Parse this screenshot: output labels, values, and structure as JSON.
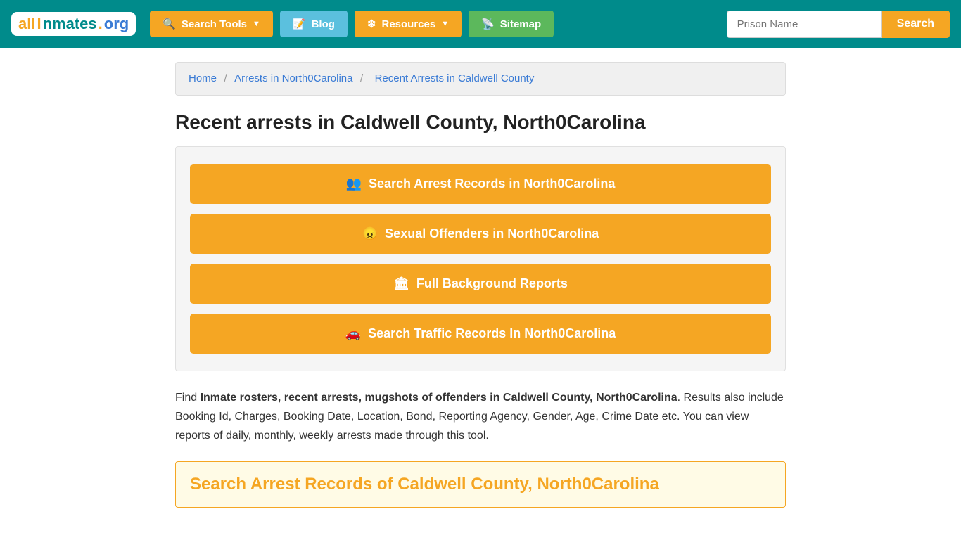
{
  "navbar": {
    "logo": {
      "all": "all",
      "inmates": "Inmates",
      "dot": ".",
      "org": "org"
    },
    "search_tools_label": "Search Tools",
    "blog_label": "Blog",
    "resources_label": "Resources",
    "sitemap_label": "Sitemap",
    "prison_name_placeholder": "Prison Name",
    "search_button_label": "Search"
  },
  "breadcrumb": {
    "home": "Home",
    "arrests": "Arrests in North0Carolina",
    "current": "Recent Arrests in Caldwell County"
  },
  "page": {
    "title": "Recent arrests in Caldwell County, North0Carolina"
  },
  "buttons": {
    "arrest_records": "Search Arrest Records in North0Carolina",
    "sexual_offenders": "Sexual Offenders in North0Carolina",
    "background_reports": "Full Background Reports",
    "traffic_records": "Search Traffic Records In North0Carolina"
  },
  "description": {
    "prefix": "Find ",
    "bold_text": "Inmate rosters, recent arrests, mugshots of offenders in Caldwell County, North0Carolina",
    "suffix": ". Results also include Booking Id, Charges, Booking Date, Location, Bond, Reporting Agency, Gender, Age, Crime Date etc. You can view reports of daily, monthly, weekly arrests made through this tool."
  },
  "search_records_box": {
    "title": "Search Arrest Records of Caldwell County, North0Carolina"
  }
}
